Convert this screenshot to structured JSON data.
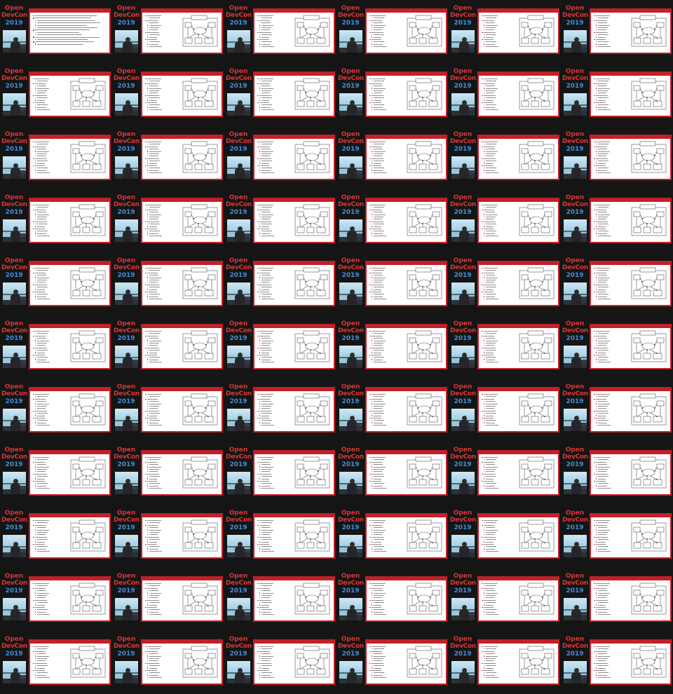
{
  "conference": {
    "logo_line_1": "Open",
    "logo_line_2": "DevCon",
    "logo_year": "2019"
  },
  "contact_sheet": {
    "columns": 6,
    "rows": 11,
    "text_slide_indices": [
      0
    ]
  },
  "colors": {
    "background": "#1d1d1d",
    "slide_accent": "#c2202a",
    "logo_red": "#d93632",
    "logo_blue": "#3f8fe0",
    "slide_body": "#ffffff"
  }
}
